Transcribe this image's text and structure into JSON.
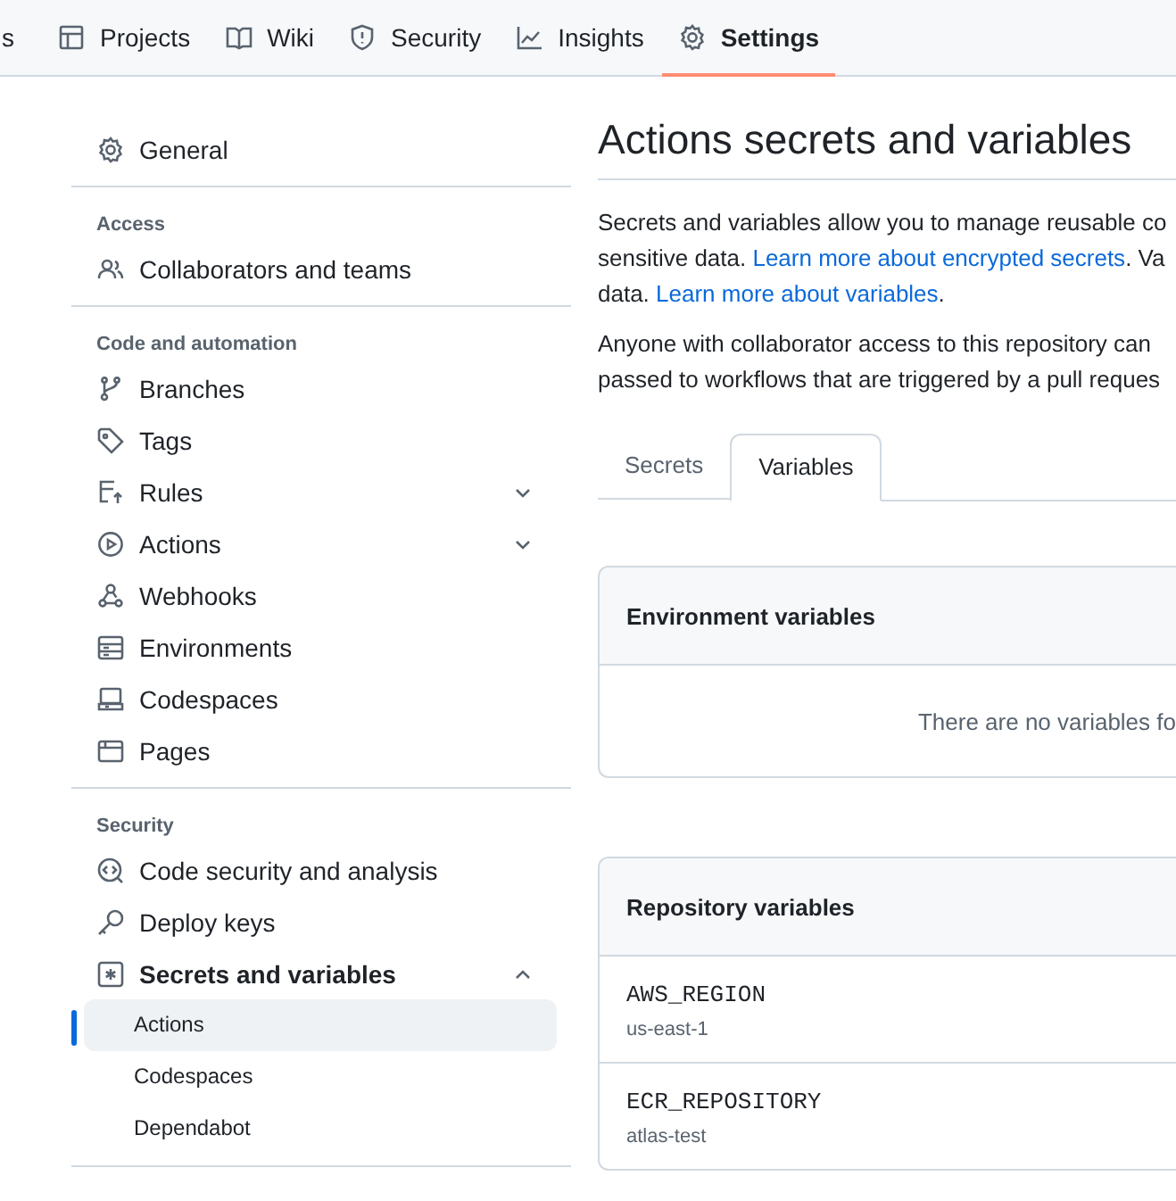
{
  "repo_nav": [
    {
      "label": "s",
      "selected": false
    },
    {
      "label": "Projects",
      "selected": false
    },
    {
      "label": "Wiki",
      "selected": false
    },
    {
      "label": "Security",
      "selected": false
    },
    {
      "label": "Insights",
      "selected": false
    },
    {
      "label": "Settings",
      "selected": true
    }
  ],
  "sidebar": {
    "groups": [
      {
        "items": [
          {
            "label": "General",
            "selected": false
          }
        ]
      },
      {
        "heading": "Access",
        "items": [
          {
            "label": "Collaborators and teams",
            "selected": false
          }
        ]
      },
      {
        "heading": "Code and automation",
        "items": [
          {
            "label": "Branches",
            "selected": false
          },
          {
            "label": "Tags",
            "selected": false
          },
          {
            "label": "Rules",
            "selected": false,
            "expanded": false
          },
          {
            "label": "Actions",
            "selected": false,
            "expanded": false
          },
          {
            "label": "Webhooks",
            "selected": false
          },
          {
            "label": "Environments",
            "selected": false
          },
          {
            "label": "Codespaces",
            "selected": false
          },
          {
            "label": "Pages",
            "selected": false
          }
        ]
      },
      {
        "heading": "Security",
        "items": [
          {
            "label": "Code security and analysis",
            "selected": false
          },
          {
            "label": "Deploy keys",
            "selected": false
          },
          {
            "label": "Secrets and variables",
            "selected": true,
            "expanded": true,
            "children": [
              {
                "label": "Actions",
                "selected": true
              },
              {
                "label": "Codespaces",
                "selected": false
              },
              {
                "label": "Dependabot",
                "selected": false
              }
            ]
          }
        ]
      }
    ]
  },
  "page": {
    "title": "Actions secrets and variables",
    "paragraphs": [
      [
        [
          {
            "text": "Secrets and variables allow you to manage reusable co"
          }
        ],
        [
          {
            "text": "sensitive data. "
          },
          {
            "text": "Learn more about encrypted secrets",
            "link": true
          },
          {
            "text": ". Va"
          }
        ],
        [
          {
            "text": "data. "
          },
          {
            "text": "Learn more about variables",
            "link": true
          },
          {
            "text": "."
          }
        ]
      ],
      [
        [
          {
            "text": "Anyone with collaborator access to this repository can"
          }
        ],
        [
          {
            "text": "passed to workflows that are triggered by a pull reques"
          }
        ]
      ]
    ],
    "tabs": [
      {
        "label": "Secrets",
        "selected": false
      },
      {
        "label": "Variables",
        "selected": true
      }
    ],
    "environment_variables": {
      "title": "Environment variables",
      "empty_message": "There are no variables fo"
    },
    "repository_variables": {
      "title": "Repository variables",
      "rows": [
        {
          "name": "AWS_REGION",
          "value": "us-east-1"
        },
        {
          "name": "ECR_REPOSITORY",
          "value": "atlas-test"
        }
      ]
    }
  }
}
